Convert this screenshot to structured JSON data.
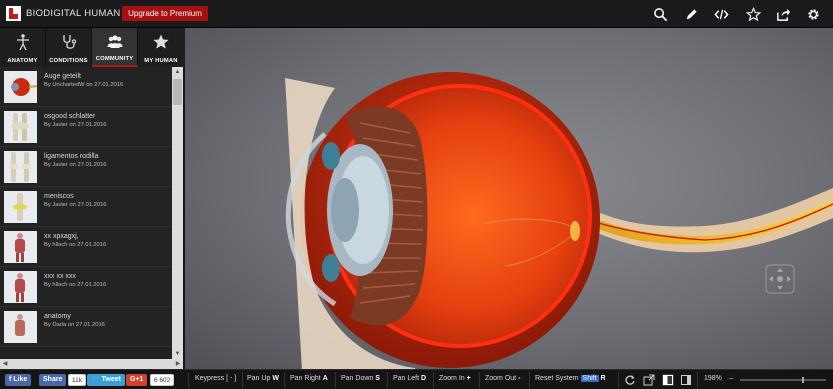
{
  "header": {
    "brand": "BIODIGITAL HUMAN",
    "upgrade_label": "Upgrade to Premium",
    "icons": [
      "search-icon",
      "pencil-icon",
      "code-icon",
      "star-icon",
      "share-icon",
      "gear-icon"
    ]
  },
  "tabs": [
    {
      "label": "ANATOMY",
      "icon": "body-icon",
      "active": false
    },
    {
      "label": "CONDITIONS",
      "icon": "stethoscope-icon",
      "active": false
    },
    {
      "label": "COMMUNITY",
      "icon": "people-icon",
      "active": true
    },
    {
      "label": "MY HUMAN",
      "icon": "star-icon",
      "active": false
    }
  ],
  "community_items": [
    {
      "title": "Auge geteilt",
      "by": "By UnchartedW on 27.01.2016",
      "thumb": "eye"
    },
    {
      "title": "osgood schlatter",
      "by": "By Javier on 27.01.2016",
      "thumb": "knee"
    },
    {
      "title": "ligamentos rodilla",
      "by": "By Javier on 27.01.2016",
      "thumb": "knee2"
    },
    {
      "title": "meniscos",
      "by": "By Javier on 27.01.2016",
      "thumb": "meniscus"
    },
    {
      "title": "xx xpxagxj,",
      "by": "By hllach on 27.01.2016",
      "thumb": "torso"
    },
    {
      "title": "xxx xx xxx",
      "by": "By hllach on 27.01.2016",
      "thumb": "torso"
    },
    {
      "title": "anatomy",
      "by": "By Darla on 27.01.2016",
      "thumb": "body"
    }
  ],
  "footer": {
    "fb_like": "Like",
    "fb_share": "Share",
    "fb_count": "11k",
    "tweet": "Tweet",
    "gplus": "G+1",
    "gplus_count": "6 602",
    "keys": [
      {
        "label": "Keypress [ - ]",
        "key": ""
      },
      {
        "label": "Pan Up",
        "key": "W"
      },
      {
        "label": "Pan Right",
        "key": "A"
      },
      {
        "label": "Pan Down",
        "key": "S"
      },
      {
        "label": "Pan Left",
        "key": "D"
      },
      {
        "label": "Zoom In",
        "key": "+"
      },
      {
        "label": "Zoom Out",
        "key": "-"
      },
      {
        "label": "Reset System",
        "key": "Shift",
        "key2": "R"
      }
    ],
    "zoom": "198%",
    "zoom_level": 0.72
  },
  "colors": {
    "accent": "#a50f10",
    "active_tab": "#b21a1a",
    "highlight": "#2e6bd3"
  }
}
